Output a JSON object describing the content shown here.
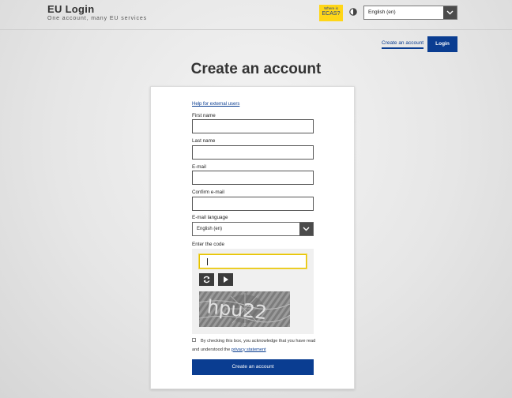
{
  "header": {
    "title": "EU Login",
    "subtitle": "One account, many EU services",
    "ecas_badge": {
      "line1": "Where is",
      "line2": "ECAS?"
    },
    "language": "English (en)"
  },
  "nav": {
    "create_account": "Create an account",
    "login": "Login"
  },
  "page_title": "Create an account",
  "form": {
    "help_link": "Help for external users",
    "fields": [
      {
        "label": "First name",
        "value": ""
      },
      {
        "label": "Last name",
        "value": ""
      },
      {
        "label": "E-mail",
        "value": ""
      },
      {
        "label": "Confirm e-mail",
        "value": ""
      }
    ],
    "email_language_label": "E-mail language",
    "email_language_value": "English (en)",
    "captcha_label": "Enter the code",
    "captcha_value": "",
    "captcha_image_text": "hpu22",
    "consent_text": "By checking this box, you acknowledge that you have read and understood the",
    "privacy_link": "privacy statement",
    "consent_checked": false,
    "submit": "Create an account"
  },
  "colors": {
    "primary": "#0a3d91",
    "ecas_yellow": "#ffd617",
    "dark_control": "#4b4b4b"
  },
  "icons": [
    "contrast-icon",
    "chevron-down-icon",
    "refresh-icon",
    "play-icon"
  ]
}
